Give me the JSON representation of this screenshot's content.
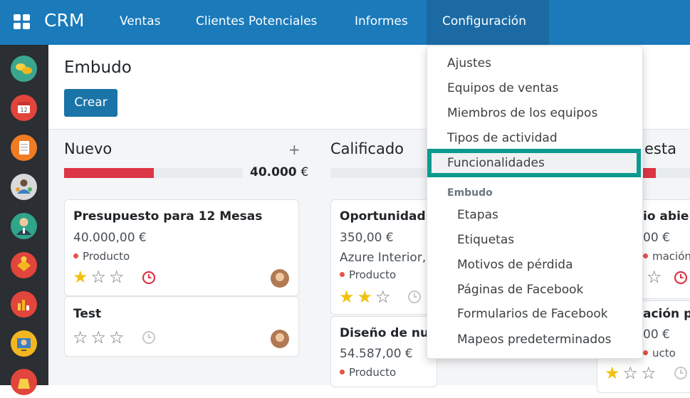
{
  "app": {
    "title": "CRM"
  },
  "nav": {
    "items": [
      "Ventas",
      "Clientes Potenciales",
      "Informes",
      "Configuración"
    ]
  },
  "page": {
    "title": "Embudo",
    "create_label": "Crear"
  },
  "columns": [
    {
      "title": "Nuevo",
      "amount": "40.000",
      "currency": "€",
      "progress": 0.5
    },
    {
      "title": "Calificado"
    },
    {
      "title": "esta"
    }
  ],
  "cards": {
    "c1": {
      "title": "Presupuesto para 12 Mesas",
      "value": "40.000,00 €",
      "tag": "Producto",
      "stars": 1
    },
    "c2": {
      "title": "Test",
      "stars": 0
    },
    "c3": {
      "title": "Oportunidad d",
      "value": "350,00 €",
      "company": "Azure Interior,",
      "tag": "Producto",
      "stars": 2
    },
    "c4": {
      "title": "Diseño de nue",
      "value": "54.587,00 €",
      "tag": "Producto"
    },
    "c5": {
      "title": "io abie",
      "value": "00 €",
      "tag": "mación",
      "stars": 1
    },
    "c6": {
      "title": "ación pa",
      "value": "00 €",
      "tag": "ucto",
      "stars": 1
    }
  },
  "dropdown": {
    "items": [
      "Ajustes",
      "Equipos de ventas",
      "Miembros de los equipos",
      "Tipos de actividad",
      "Funcionalidades"
    ],
    "section_header": "Embudo",
    "pipeline_items": [
      "Etapas",
      "Etiquetas",
      "Motivos de pérdida",
      "Páginas de Facebook",
      "Formularios de Facebook",
      "Mapeos predeterminados"
    ],
    "highlighted": "Funcionalidades"
  },
  "sidebar": {
    "icons": [
      "discuss-icon",
      "calendar-icon",
      "notes-icon",
      "contacts-icon",
      "employees-icon",
      "crm-icon",
      "reporting-icon",
      "website-icon",
      "invoicing-icon"
    ]
  },
  "colors": {
    "topbar": "#1a7aba",
    "accent": "#1a74a8",
    "highlight": "#0c9a8e",
    "sidebar": "#2b2e33",
    "danger": "#dc3545",
    "star": "#f3c00e"
  }
}
